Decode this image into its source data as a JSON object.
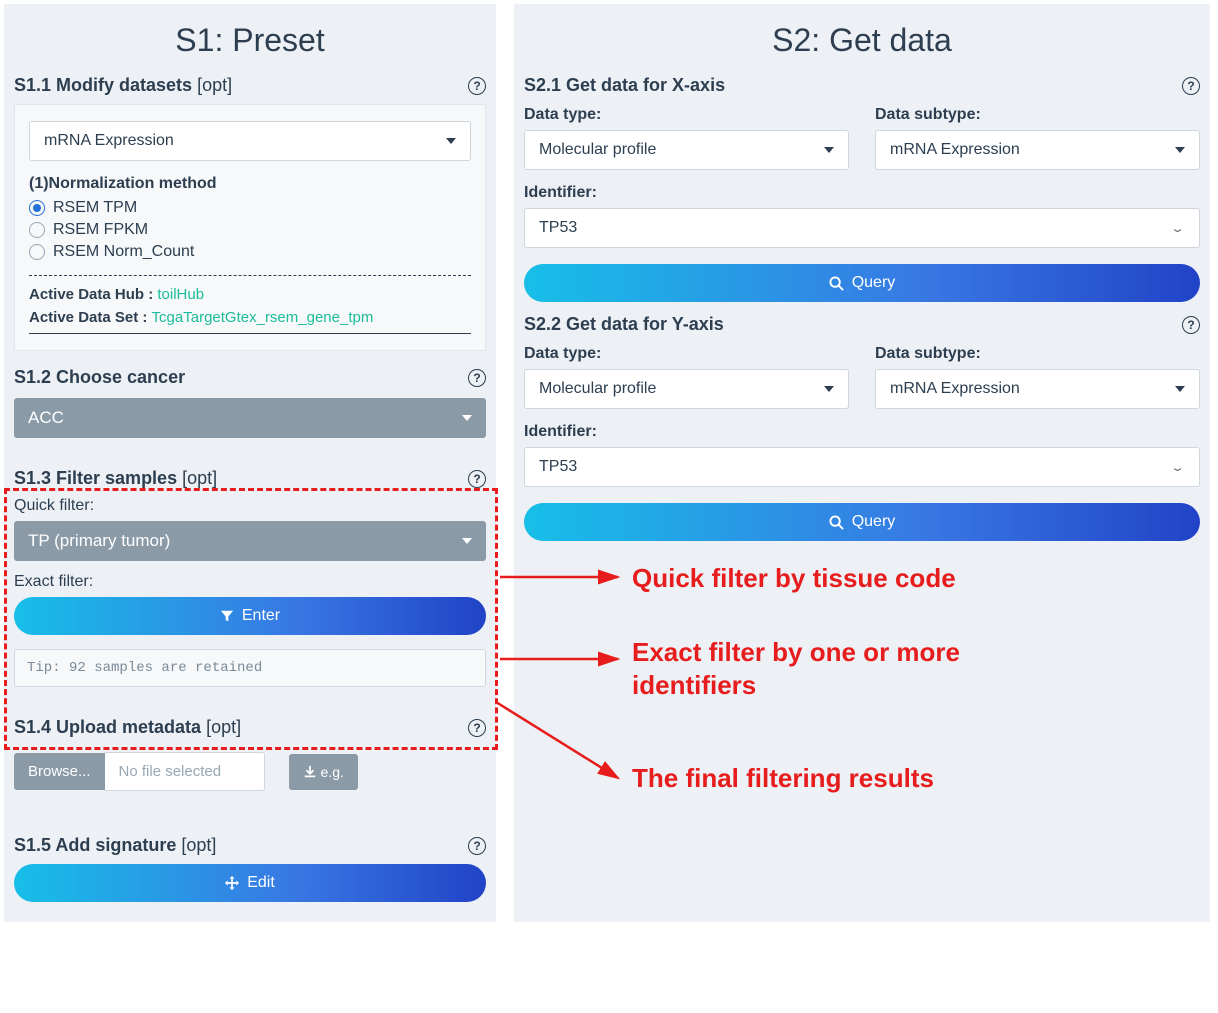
{
  "colors": {
    "accent_teal": "#1bbc9b",
    "gradient_start": "#17bfe8",
    "gradient_end": "#2143c7",
    "gray_btn": "#8a9aa6",
    "callout_red": "#e71c1c"
  },
  "left": {
    "title": "S1: Preset",
    "s1_1": {
      "heading_bold": "S1.1 Modify datasets",
      "heading_opt": " [opt]",
      "dropdown_value": "mRNA Expression",
      "norm_label": "(1)Normalization method",
      "norm_options": [
        {
          "label": "RSEM TPM",
          "checked": true
        },
        {
          "label": "RSEM FPKM",
          "checked": false
        },
        {
          "label": "RSEM Norm_Count",
          "checked": false
        }
      ],
      "hub_label": "Active Data Hub : ",
      "hub_value": "toilHub",
      "set_label": "Active Data Set : ",
      "set_value": "TcgaTargetGtex_rsem_gene_tpm"
    },
    "s1_2": {
      "heading_bold": "S1.2 Choose cancer",
      "value": "ACC"
    },
    "s1_3": {
      "heading_bold": "S1.3 Filter samples",
      "heading_opt": " [opt]",
      "quick_label": "Quick filter:",
      "quick_value": "TP (primary tumor)",
      "exact_label": "Exact filter:",
      "enter_label": "Enter",
      "tip_text": "Tip: 92 samples are retained"
    },
    "s1_4": {
      "heading_bold": "S1.4 Upload metadata",
      "heading_opt": " [opt]",
      "browse_label": "Browse...",
      "nofile_label": "No file selected",
      "eg_label": "e.g."
    },
    "s1_5": {
      "heading_bold": "S1.5 Add signature",
      "heading_opt": " [opt]",
      "edit_label": "Edit"
    }
  },
  "right": {
    "title": "S2: Get data",
    "s2_1": {
      "heading_bold": "S2.1 Get data for X-axis",
      "dtype_label": "Data type:",
      "dtype_value": "Molecular profile",
      "subtype_label": "Data subtype:",
      "subtype_value": "mRNA Expression",
      "id_label": "Identifier:",
      "id_value": "TP53",
      "query_label": "Query"
    },
    "s2_2": {
      "heading_bold": "S2.2 Get data for Y-axis",
      "dtype_label": "Data type:",
      "dtype_value": "Molecular profile",
      "subtype_label": "Data subtype:",
      "subtype_value": "mRNA Expression",
      "id_label": "Identifier:",
      "id_value": "TP53",
      "query_label": "Query"
    }
  },
  "annotations": {
    "a1": "Quick filter by tissue code",
    "a2": "Exact filter by one or more identifiers",
    "a3": "The final filtering results"
  }
}
